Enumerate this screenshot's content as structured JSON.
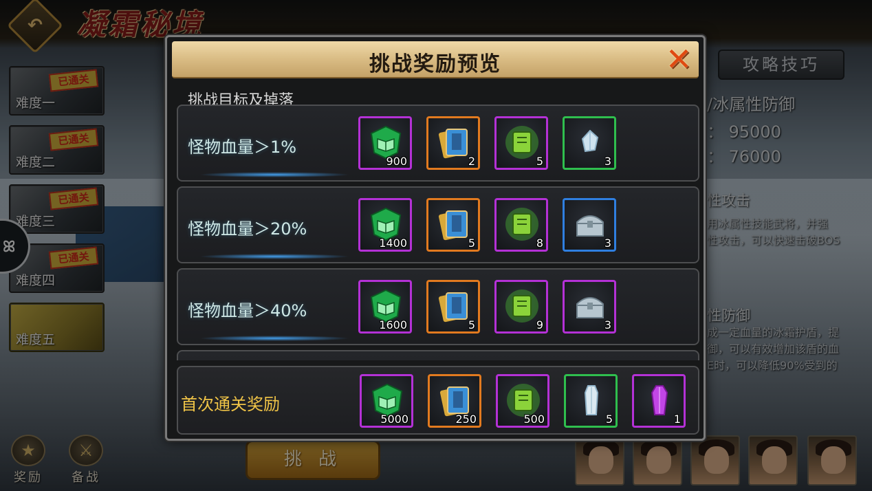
{
  "header": {
    "stage_title": "凝霜秘境",
    "back_icon": "return-arrow-icon"
  },
  "difficulties": [
    {
      "label": "难度一",
      "stamp": "已通关"
    },
    {
      "label": "难度二",
      "stamp": "已通关"
    },
    {
      "label": "难度三",
      "stamp": "已通关"
    },
    {
      "label": "难度四",
      "stamp": "已通关"
    },
    {
      "label": "难度五",
      "stamp": ""
    }
  ],
  "bottom_buttons": {
    "reward": "奖励",
    "prepare": "备战"
  },
  "challenge_button": "挑 战",
  "right_panel": {
    "tips_button": "攻略技巧",
    "defense_title": "/冰属性防御",
    "stat_1": "： 95000",
    "stat_2": "： 76000",
    "attack_title": "性攻击",
    "attack_line_1": "用冰属性技能武将，并强",
    "attack_line_2": "性攻击，可以快速击破BOS",
    "defense_sub_title": "性防御",
    "defense_line_1": "成一定血量的冰霜护盾，提",
    "defense_line_2": "御，可以有效增加该盾的血",
    "defense_line_3": "E时，可以降低90%受到的"
  },
  "modal": {
    "title": "挑战奖励预览",
    "close_icon": "close-x-icon",
    "section_label": "挑战目标及掉落",
    "tiers": [
      {
        "condition": "怪物血量＞1%",
        "items": [
          {
            "icon": "green-skill-book-icon",
            "rarity": "purple",
            "count": "900"
          },
          {
            "icon": "blue-scroll-icon",
            "rarity": "orange",
            "count": "2"
          },
          {
            "icon": "green-tome-icon",
            "rarity": "purple",
            "count": "5"
          },
          {
            "icon": "ice-crystal-icon",
            "rarity": "green",
            "count": "3"
          }
        ]
      },
      {
        "condition": "怪物血量＞20%",
        "items": [
          {
            "icon": "green-skill-book-icon",
            "rarity": "purple",
            "count": "1400"
          },
          {
            "icon": "blue-scroll-icon",
            "rarity": "orange",
            "count": "5"
          },
          {
            "icon": "green-tome-icon",
            "rarity": "purple",
            "count": "8"
          },
          {
            "icon": "silver-chest-icon",
            "rarity": "blue",
            "count": "3"
          }
        ]
      },
      {
        "condition": "怪物血量＞40%",
        "items": [
          {
            "icon": "green-skill-book-icon",
            "rarity": "purple",
            "count": "1600"
          },
          {
            "icon": "blue-scroll-icon",
            "rarity": "orange",
            "count": "5"
          },
          {
            "icon": "green-tome-icon",
            "rarity": "purple",
            "count": "9"
          },
          {
            "icon": "silver-chest-icon",
            "rarity": "purple",
            "count": "3"
          }
        ]
      }
    ],
    "first_clear": {
      "label": "首次通关奖励",
      "items": [
        {
          "icon": "green-skill-book-icon",
          "rarity": "purple",
          "count": "5000"
        },
        {
          "icon": "blue-scroll-icon",
          "rarity": "orange",
          "count": "250"
        },
        {
          "icon": "green-tome-icon",
          "rarity": "purple",
          "count": "500"
        },
        {
          "icon": "ice-shard-icon",
          "rarity": "green",
          "count": "5"
        },
        {
          "icon": "purple-crystal-icon",
          "rarity": "purple",
          "count": "1"
        }
      ]
    }
  },
  "heroes": [
    "hero-portrait-female",
    "hero-portrait-masked",
    "hero-portrait-warrior",
    "hero-portrait-scholar",
    "hero-portrait-general"
  ]
}
